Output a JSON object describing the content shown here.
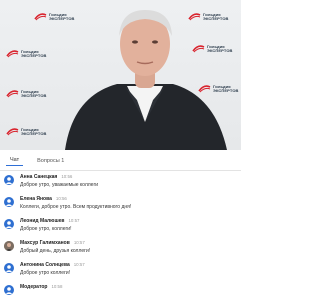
{
  "branding": {
    "logo_text": "Гильдия\nЭКСПЕРТОВ",
    "accent_color": "#d9232d"
  },
  "tabs": [
    {
      "label": "Чат",
      "active": true
    },
    {
      "label": "Вопросы",
      "count": "1"
    }
  ],
  "messages": [
    {
      "name": "Анна Санецкая",
      "time": "10:56",
      "text": "Доброе утро, уважаемые коллеги",
      "avatar": "user-icon"
    },
    {
      "name": "Елена Янова",
      "time": "10:56",
      "text": "Коллеги, доброе утро. Всем продуктивного дня!",
      "avatar": "user-icon"
    },
    {
      "name": "Леонид Малюшев",
      "time": "10:57",
      "text": "Доброе утро, коллеги!",
      "avatar": "user-icon"
    },
    {
      "name": "Махсур Галимханов",
      "time": "10:57",
      "text": "Добрый день, друзья коллеги!",
      "avatar": "photo"
    },
    {
      "name": "Антонина Солнцева",
      "time": "10:57",
      "text": "Доброе утро коллеги!",
      "avatar": "user-icon"
    },
    {
      "name": "Модератор",
      "time": "10:58",
      "text": "",
      "avatar": "user-icon"
    }
  ]
}
